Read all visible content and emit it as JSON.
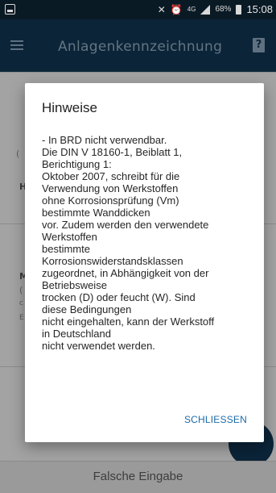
{
  "status_bar": {
    "network": "4G",
    "battery": "68%",
    "time": "15:08"
  },
  "app_bar": {
    "title": "Anlagenkennzeichnung",
    "icons": [
      "menu-icon",
      "help-icon"
    ]
  },
  "background": {
    "fragments": [
      "(",
      "H",
      "(",
      "M",
      "c",
      "E"
    ],
    "bottom_button": "Falsche Eingabe"
  },
  "dialog": {
    "title": "Hinweise",
    "body": " - In BRD nicht verwendbar.\nDie DIN V 18160-1, Beiblatt 1,\nBerichtigung 1:\nOktober 2007, schreibt für die\nVerwendung von Werkstoffen\nohne Korrosionsprüfung (Vm)\nbestimmte Wanddicken\nvor. Zudem werden den verwendete\nWerkstoffen\nbestimmte\nKorrosionswiderstandsklassen\nzugeordnet, in Abhängigkeit von der\nBetriebsweise\ntrocken (D) oder feucht (W). Sind\ndiese Bedingungen\nnicht eingehalten, kann der Werkstoff\nin Deutschland\nnicht verwendet werden.",
    "close_label": "SCHLIESSEN"
  }
}
